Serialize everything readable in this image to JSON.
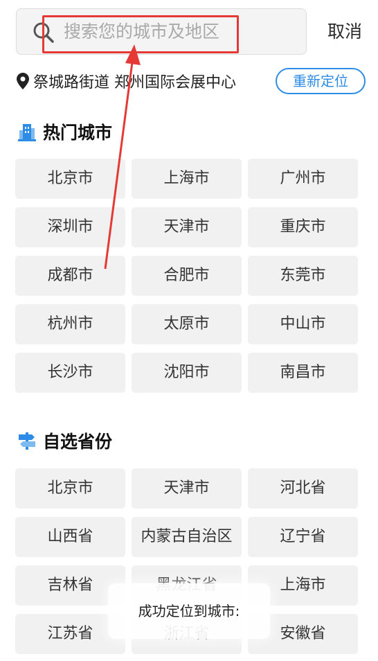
{
  "search": {
    "placeholder": "搜索您的城市及地区",
    "value": ""
  },
  "cancel_label": "取消",
  "location": {
    "text": "祭城路街道 郑州国际会展中心",
    "relocate_label": "重新定位"
  },
  "hot_cities": {
    "title": "热门城市",
    "items": [
      "北京市",
      "上海市",
      "广州市",
      "深圳市",
      "天津市",
      "重庆市",
      "成都市",
      "合肥市",
      "东莞市",
      "杭州市",
      "太原市",
      "中山市",
      "长沙市",
      "沈阳市",
      "南昌市"
    ]
  },
  "provinces": {
    "title": "自选省份",
    "items": [
      "北京市",
      "天津市",
      "河北省",
      "山西省",
      "内蒙古自治区",
      "辽宁省",
      "吉林省",
      "黑龙江省",
      "上海市",
      "江苏省",
      "浙江省",
      "安徽省"
    ]
  },
  "toast": {
    "text": "成功定位到城市:"
  },
  "colors": {
    "accent": "#2c8ce6",
    "annotation": "#e53935",
    "cell_bg": "#f1f1f1"
  },
  "icons": [
    "search-icon",
    "location-pin-icon",
    "building-icon",
    "signpost-icon"
  ]
}
